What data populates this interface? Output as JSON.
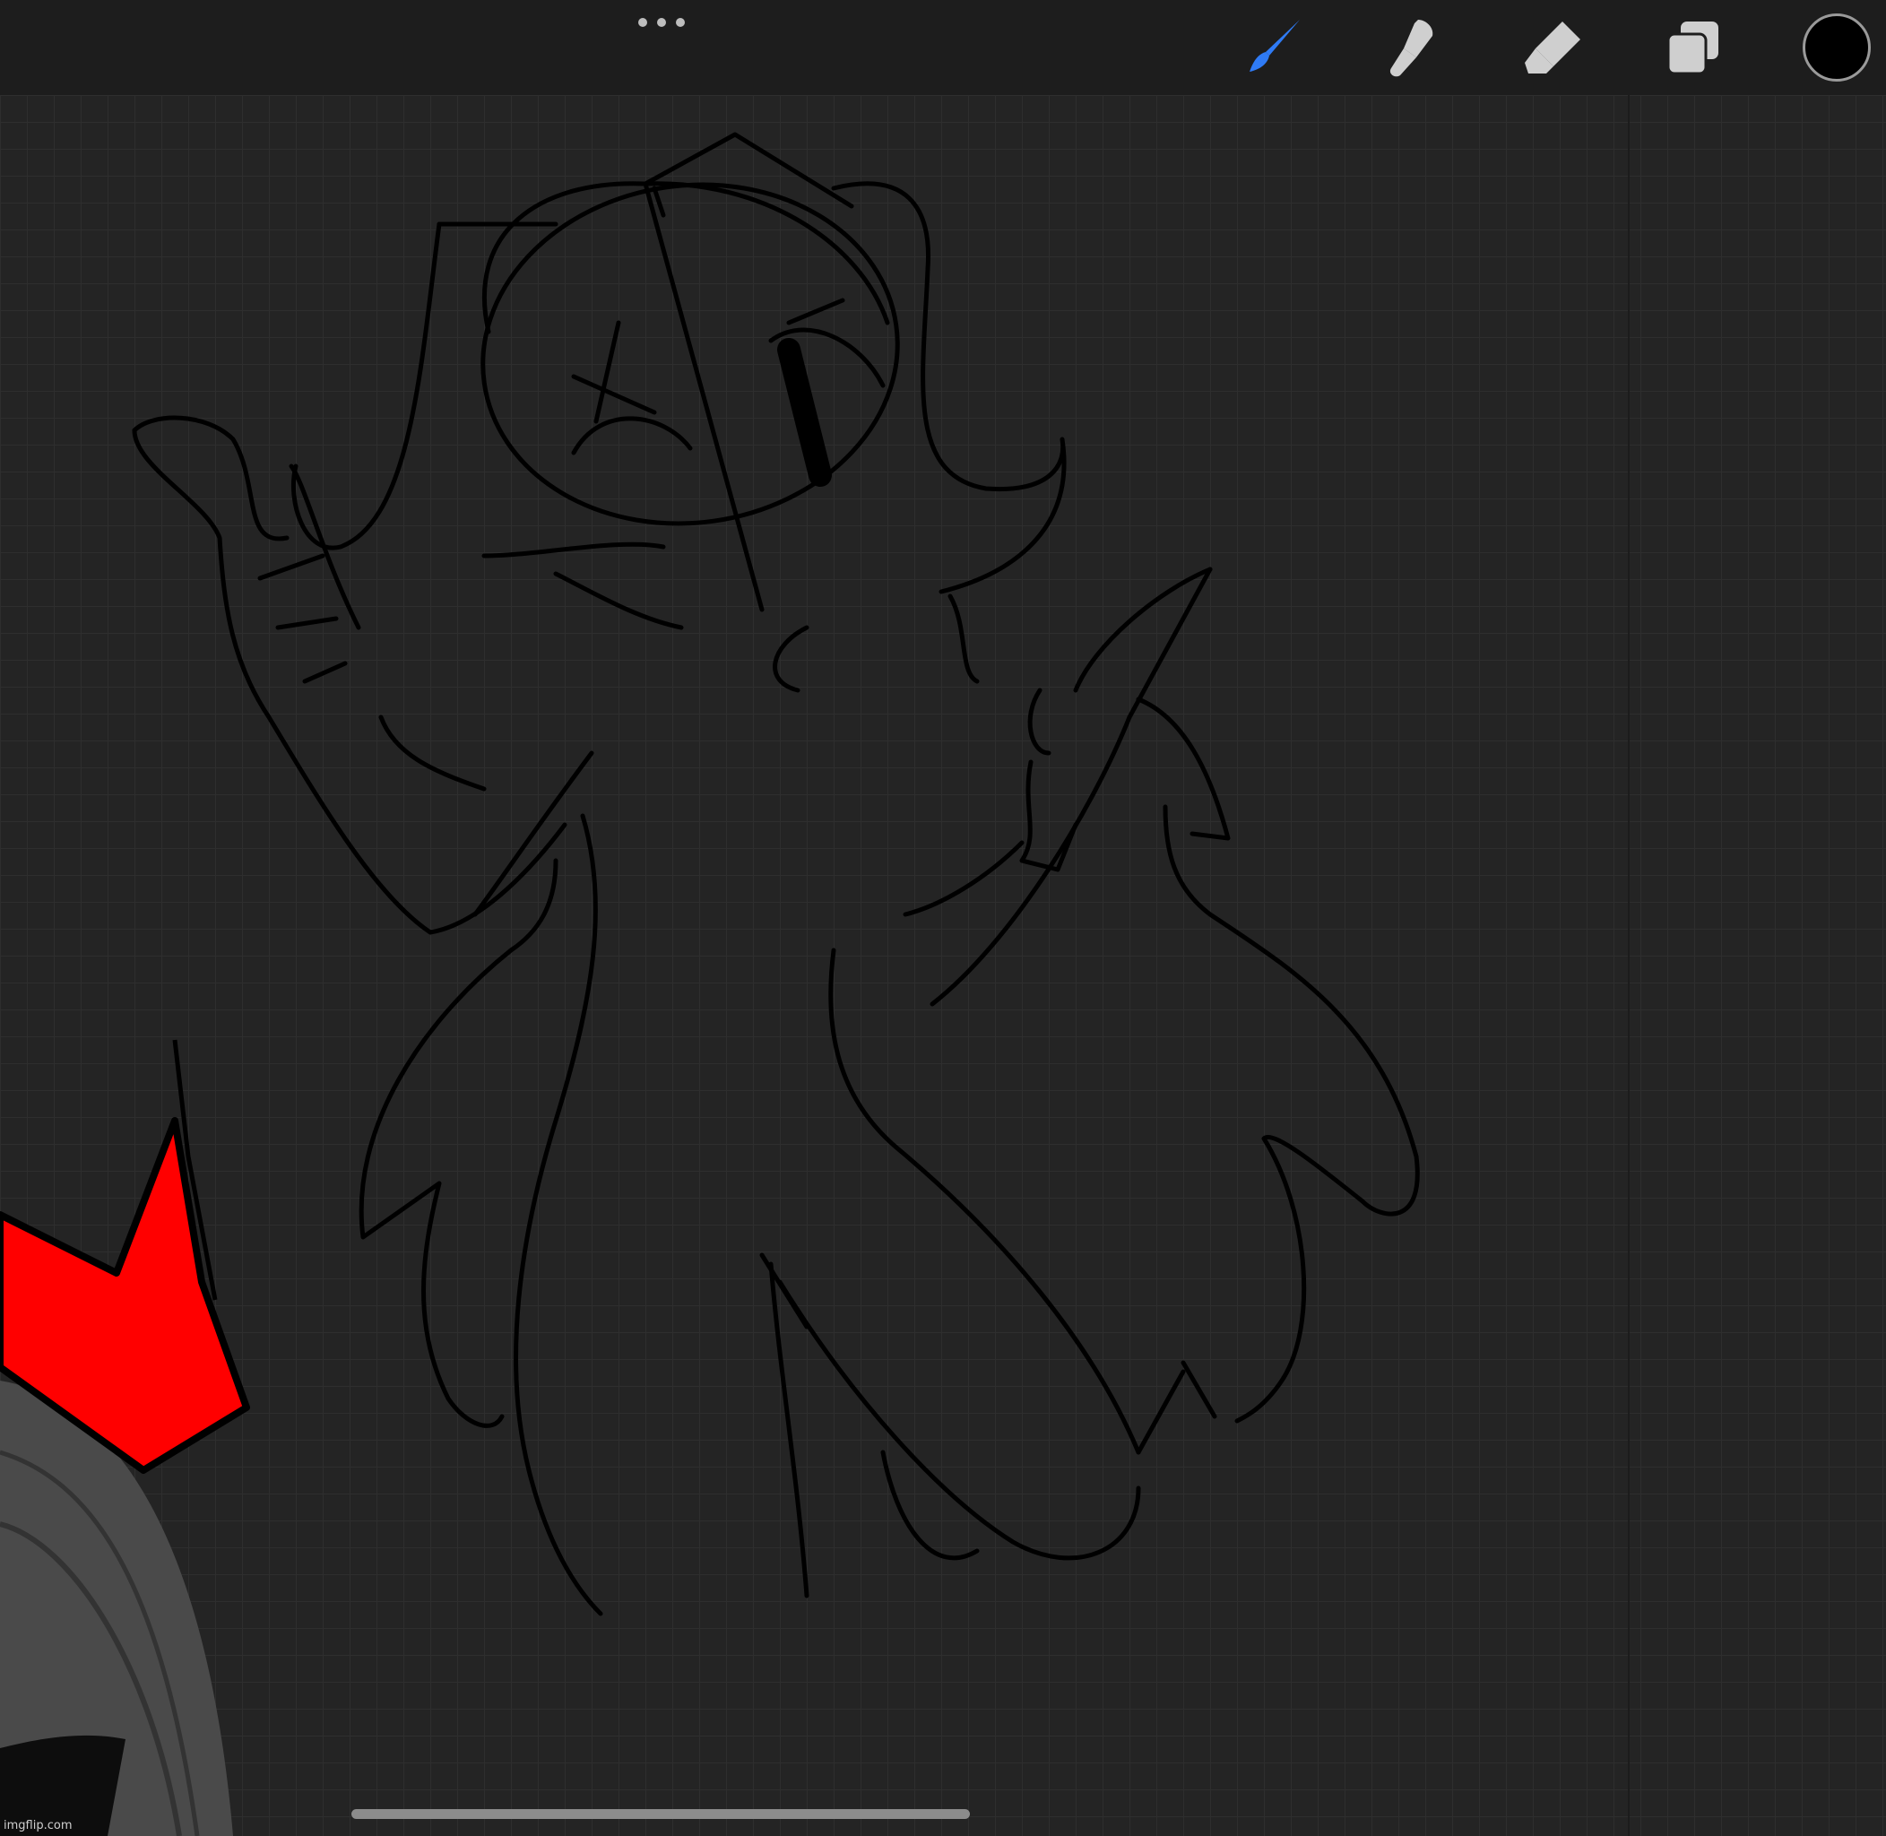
{
  "toolbar": {
    "more_menu_icon": "ellipsis-icon",
    "tools": [
      {
        "name": "brush",
        "icon": "brush-icon",
        "active": true,
        "color": "#2f7bf5"
      },
      {
        "name": "smudge",
        "icon": "smudge-icon",
        "active": false,
        "color": "#cfcfcf"
      },
      {
        "name": "eraser",
        "icon": "eraser-icon",
        "active": false,
        "color": "#cfcfcf"
      },
      {
        "name": "layers",
        "icon": "layers-icon",
        "active": false,
        "color": "#cfcfcf"
      }
    ],
    "current_color": "#000000"
  },
  "canvas": {
    "background": "#242424",
    "accent_red": "#ff0000"
  },
  "watermark": "imgflip.com"
}
